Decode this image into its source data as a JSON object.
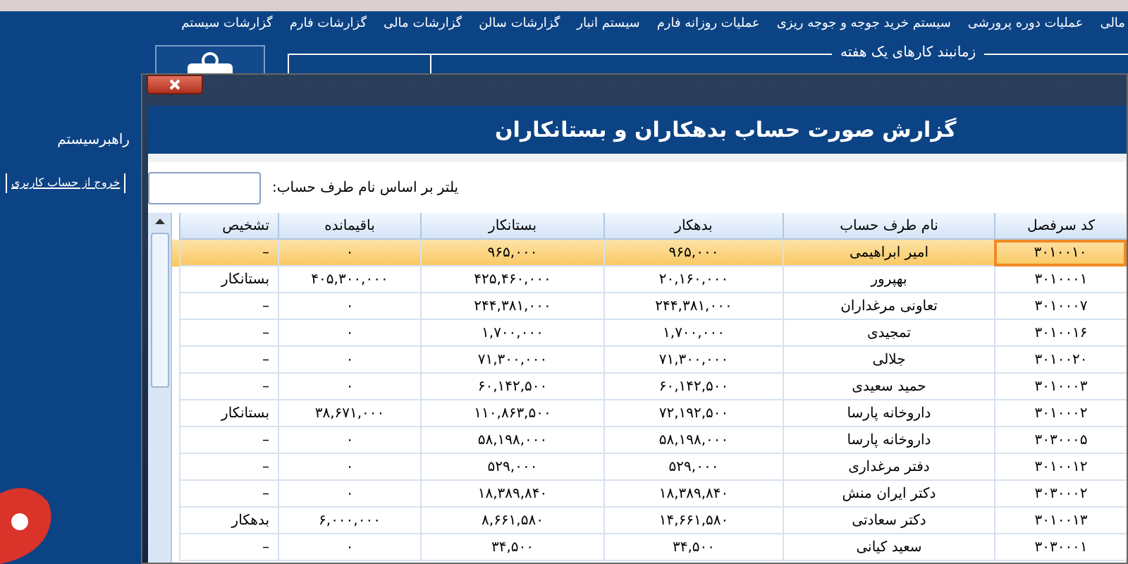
{
  "menu": [
    {
      "label": "مالی"
    },
    {
      "label": "عملیات دوره پرورشی"
    },
    {
      "label": "سیستم خرید جوجه و جوجه ریزی"
    },
    {
      "label": "عملیات روزانه فارم"
    },
    {
      "label": "سیستم انبار"
    },
    {
      "label": "گزارشات سالن"
    },
    {
      "label": "گزارشات مالی"
    },
    {
      "label": "گزارشات فارم"
    },
    {
      "label": "گزارشات سیستم"
    }
  ],
  "group_box": {
    "title": "زمانبند کارهای یک هفته"
  },
  "sidebar": {
    "user": "راهبرسیستم",
    "logout_link": "خروج از حساب کاربری"
  },
  "dialog": {
    "title": "گزارش صورت حساب بدهکاران و بستانکاران",
    "filter": {
      "label": "یلتر بر اساس نام طرف حساب:"
    },
    "table": {
      "columns": [
        "کد سرفصل",
        "نام طرف حساب",
        "بدهکار",
        "بستانکار",
        "باقیمانده",
        "تشخیص"
      ],
      "rows": [
        {
          "selected": true,
          "cells": [
            "۳۰۱۰۰۱۰",
            "امیر ابراهیمی",
            "۹۶۵,۰۰۰",
            "۹۶۵,۰۰۰",
            "۰",
            "–"
          ]
        },
        {
          "selected": false,
          "cells": [
            "۳۰۱۰۰۰۱",
            "بهپرور",
            "۲۰,۱۶۰,۰۰۰",
            "۴۲۵,۴۶۰,۰۰۰",
            "۴۰۵,۳۰۰,۰۰۰",
            "بستانکار"
          ]
        },
        {
          "selected": false,
          "cells": [
            "۳۰۱۰۰۰۷",
            "تعاونی مرغداران",
            "۲۴۴,۳۸۱,۰۰۰",
            "۲۴۴,۳۸۱,۰۰۰",
            "۰",
            "–"
          ]
        },
        {
          "selected": false,
          "cells": [
            "۳۰۱۰۰۱۶",
            "تمجیدی",
            "۱,۷۰۰,۰۰۰",
            "۱,۷۰۰,۰۰۰",
            "۰",
            "–"
          ]
        },
        {
          "selected": false,
          "cells": [
            "۳۰۱۰۰۲۰",
            "جلالی",
            "۷۱,۳۰۰,۰۰۰",
            "۷۱,۳۰۰,۰۰۰",
            "۰",
            "–"
          ]
        },
        {
          "selected": false,
          "cells": [
            "۳۰۱۰۰۰۳",
            "حمید سعیدی",
            "۶۰,۱۴۲,۵۰۰",
            "۶۰,۱۴۲,۵۰۰",
            "۰",
            "–"
          ]
        },
        {
          "selected": false,
          "cells": [
            "۳۰۱۰۰۰۲",
            "داروخانه پارسا",
            "۷۲,۱۹۲,۵۰۰",
            "۱۱۰,۸۶۳,۵۰۰",
            "۳۸,۶۷۱,۰۰۰",
            "بستانکار"
          ]
        },
        {
          "selected": false,
          "cells": [
            "۳۰۳۰۰۰۵",
            "داروخانه پارسا",
            "۵۸,۱۹۸,۰۰۰",
            "۵۸,۱۹۸,۰۰۰",
            "۰",
            "–"
          ]
        },
        {
          "selected": false,
          "cells": [
            "۳۰۱۰۰۱۲",
            "دفتر مرغداری",
            "۵۲۹,۰۰۰",
            "۵۲۹,۰۰۰",
            "۰",
            "–"
          ]
        },
        {
          "selected": false,
          "cells": [
            "۳۰۳۰۰۰۲",
            "دکتر ایران منش",
            "۱۸,۳۸۹,۸۴۰",
            "۱۸,۳۸۹,۸۴۰",
            "۰",
            "–"
          ]
        },
        {
          "selected": false,
          "cells": [
            "۳۰۱۰۰۱۳",
            "دکتر سعادتی",
            "۱۴,۶۶۱,۵۸۰",
            "۸,۶۶۱,۵۸۰",
            "۶,۰۰۰,۰۰۰",
            "بدهکار"
          ]
        },
        {
          "selected": false,
          "cells": [
            "۳۰۳۰۰۰۱",
            "سعید کیانی",
            "۳۴,۵۰۰",
            "۳۴,۵۰۰",
            "۰",
            "–"
          ]
        }
      ]
    }
  }
}
